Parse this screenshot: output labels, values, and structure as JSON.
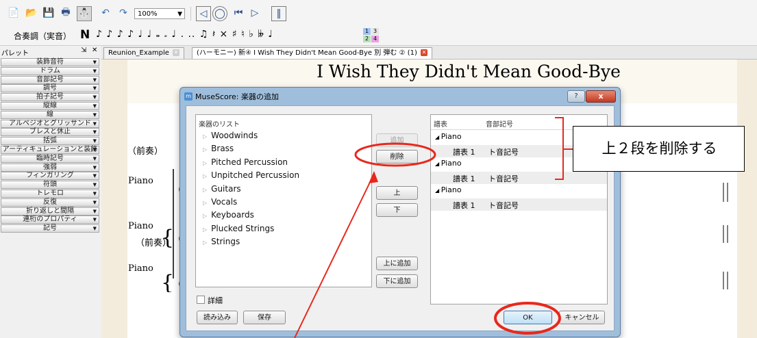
{
  "toolbar": {
    "zoom": "100%",
    "concert_pitch_label": "合奏調（実音）",
    "note_input_label": "N",
    "note_glyphs": "♪ ♪ ♪ ♪ ♩ ♩ 𝅝 𝅗 ♩ .  .. ♫ 𝄽 ×  ♯ ♮ ♭ 𝄫 ♩",
    "voice_labels": [
      "1",
      "3",
      "2",
      "4"
    ]
  },
  "palette": {
    "title": "パレット",
    "items": [
      "装飾音符",
      "ドラム",
      "音部記号",
      "調号",
      "拍子記号",
      "縦線",
      "線",
      "アルペジオとグリッサンド",
      "ブレスと休止",
      "括弧",
      "アーティキュレーションと装飾",
      "臨時記号",
      "強弱",
      "フィンガリング",
      "符頭",
      "トレモロ",
      "反復",
      "折り返しと間隔",
      "連桁のプロパティ",
      "記号"
    ]
  },
  "tabs": [
    {
      "label": "Reunion_Example"
    },
    {
      "label": "(ハーモニー) 新④ I Wish They Didn't Mean Good-Bye 別 弾む ② (1)"
    }
  ],
  "score": {
    "title": "I Wish They Didn't Mean Good-Bye",
    "intro_label_1": "（前奏）",
    "intro_label_2": "（前奏）",
    "piano_1": "Piano",
    "piano_2": "Piano",
    "piano_3": "Piano"
  },
  "dialog": {
    "title": "MuseScore: 楽器の追加",
    "help": "?",
    "close": "x",
    "instrument_list_header": "楽器のリスト",
    "instrument_groups": [
      "Woodwinds",
      "Brass",
      "Pitched Percussion",
      "Unpitched Percussion",
      "Guitars",
      "Vocals",
      "Keyboards",
      "Plucked Strings",
      "Strings"
    ],
    "buttons": {
      "add": "追加",
      "remove": "削除",
      "up": "上",
      "down": "下",
      "add_above": "上に追加",
      "add_below": "下に追加",
      "load": "読み込み",
      "save": "保存",
      "ok": "OK",
      "cancel": "キャンセル"
    },
    "detail_label": "詳細",
    "staves_header": "譜表",
    "clef_header": "音部記号",
    "instruments": [
      {
        "name": "Piano",
        "staff": "譜表 1",
        "clef": "ト音記号"
      },
      {
        "name": "Piano",
        "staff": "譜表 1",
        "clef": "ト音記号"
      },
      {
        "name": "Piano",
        "staff": "譜表 1",
        "clef": "ト音記号"
      }
    ]
  },
  "annotation": {
    "text": "上２段を削除する",
    "color": "#e8281c"
  }
}
